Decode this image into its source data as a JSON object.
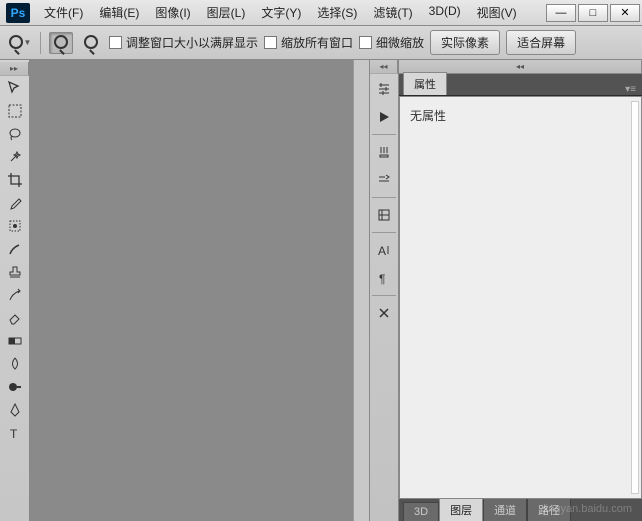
{
  "app": {
    "logo": "Ps"
  },
  "menu": {
    "file": "文件(F)",
    "edit": "编辑(E)",
    "image": "图像(I)",
    "layer": "图层(L)",
    "type": "文字(Y)",
    "select": "选择(S)",
    "filter": "滤镜(T)",
    "threeD": "3D(D)",
    "view": "视图(V)"
  },
  "window_controls": {
    "min": "—",
    "max": "□",
    "close": "✕"
  },
  "options": {
    "resize_to_fit": "调整窗口大小以满屏显示",
    "zoom_all": "缩放所有窗口",
    "scrubby": "细微缩放",
    "actual_pixels": "实际像素",
    "fit_screen": "适合屏幕"
  },
  "properties": {
    "tab_label": "属性",
    "empty_text": "无属性"
  },
  "bottom_tabs": {
    "threeD": "3D",
    "layers": "图层",
    "channels": "通道",
    "paths": "路径"
  },
  "watermark": "jingyan.baidu.com"
}
